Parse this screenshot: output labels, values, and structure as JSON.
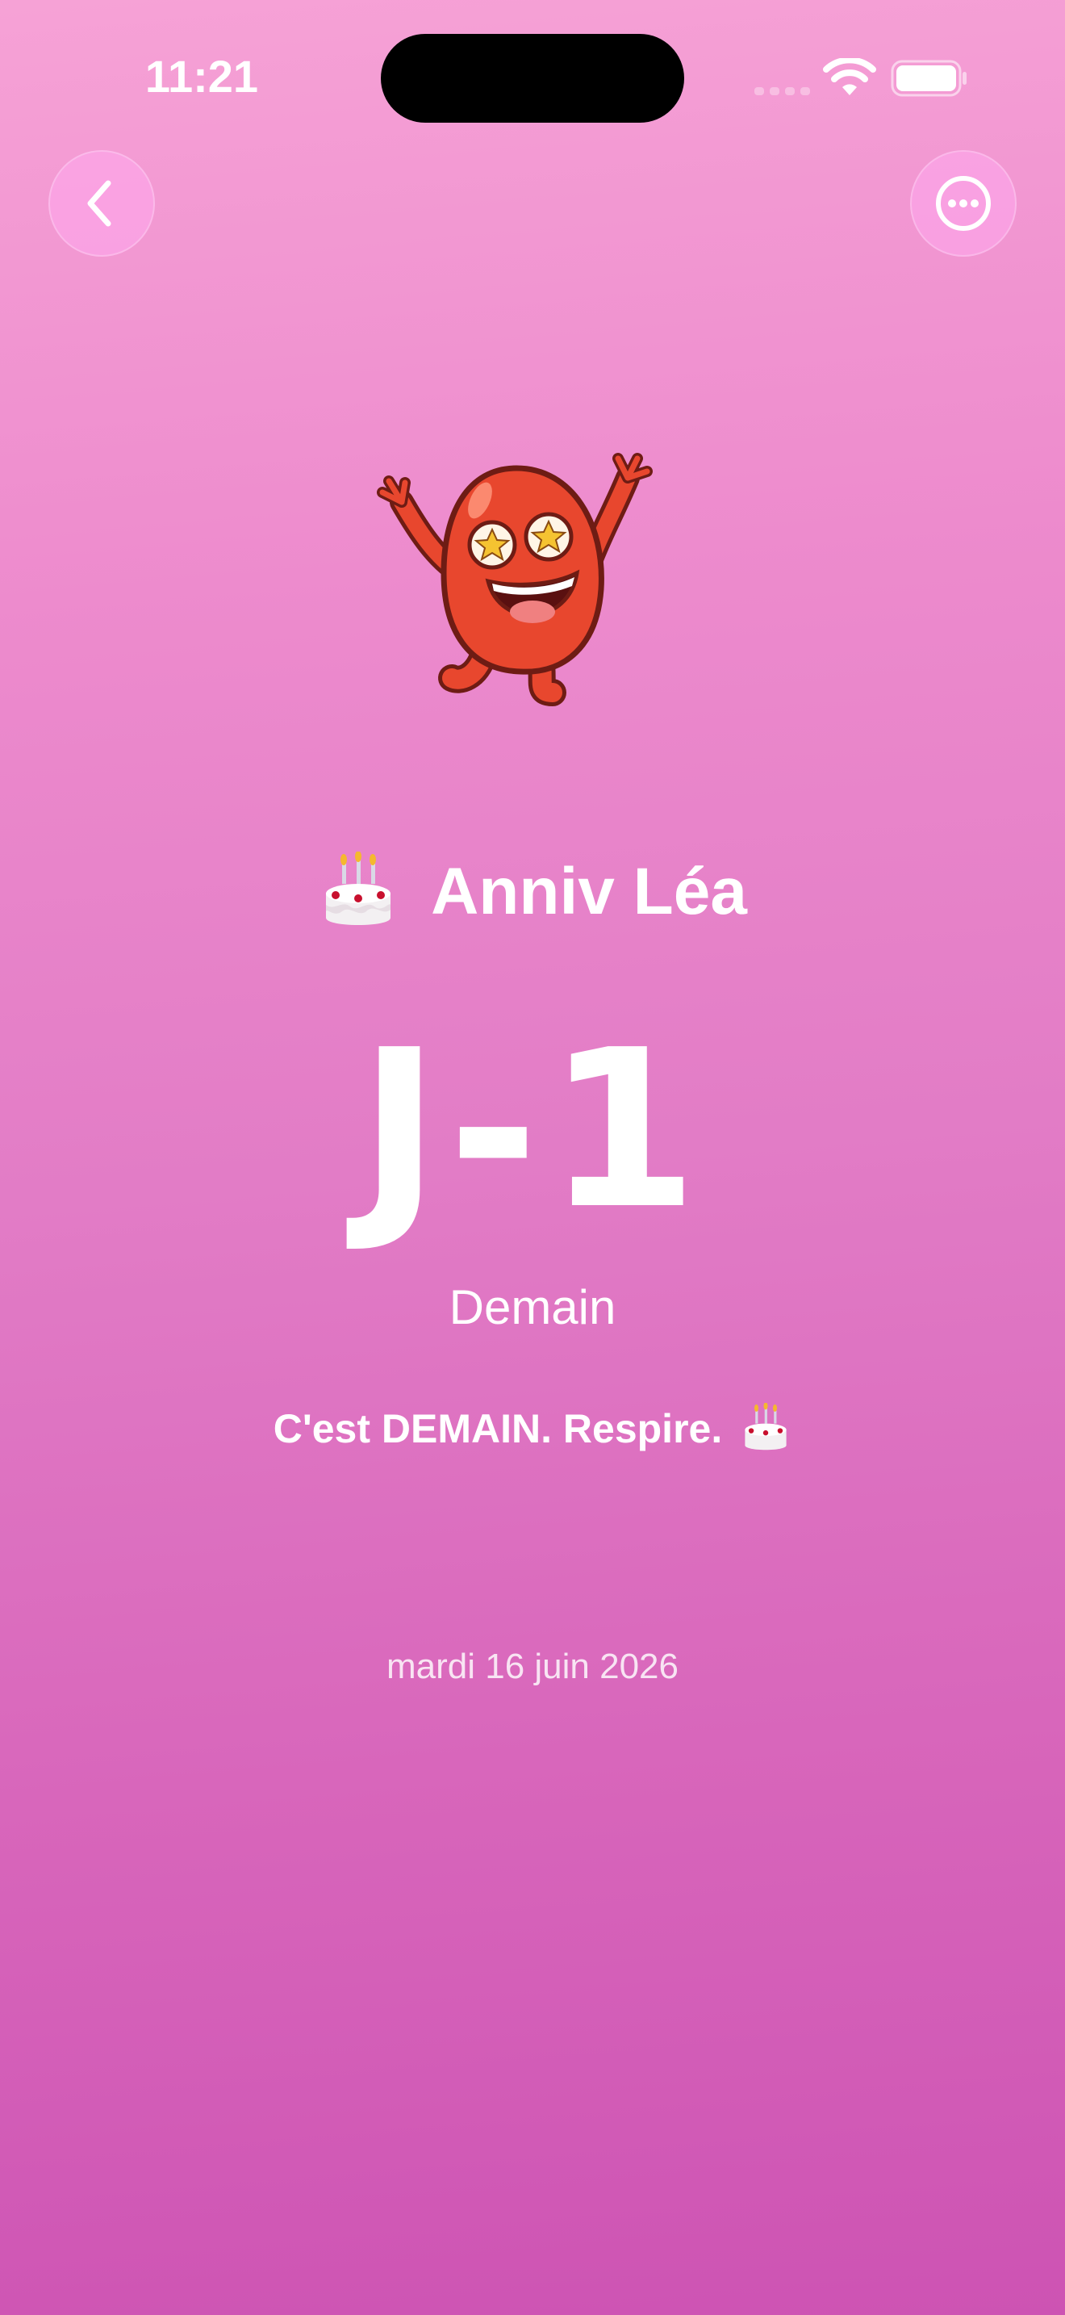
{
  "status_bar": {
    "time": "11:21"
  },
  "nav": {
    "back_icon": "chevron-left-icon",
    "more_icon": "ellipsis-circle-icon"
  },
  "event": {
    "emoji": "🎂",
    "title": "Anniv Léa",
    "countdown": "J-1",
    "relative_day": "Demain",
    "message": "C'est DEMAIN. Respire.",
    "message_emoji": "🎂",
    "date": "mardi 16 juin 2026"
  },
  "colors": {
    "background_top": "#f6a2d6",
    "background_bottom": "#cd53b3",
    "mascot": "#e8472e",
    "text": "#ffffff"
  }
}
